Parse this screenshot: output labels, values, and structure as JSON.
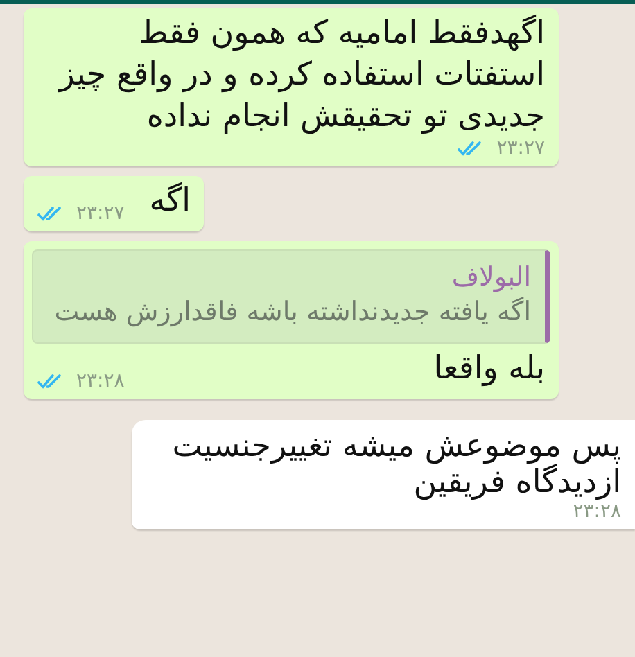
{
  "messages": [
    {
      "kind": "outgoing",
      "text": "اگهدفقط امامیه که همون فقط استفتات استفاده کرده و در واقع چیز جدیدی تو تحقیقش انجام نداده",
      "time": "۲۳:۲۷",
      "read": true
    },
    {
      "kind": "outgoing",
      "text": "اگه",
      "time": "۲۳:۲۷",
      "read": true
    },
    {
      "kind": "outgoing",
      "quote": {
        "author": "البولاف",
        "text": "اگه یافته جدیدنداشته باشه فاقدارزش هست"
      },
      "text": "بله واقعا",
      "time": "۲۳:۲۸",
      "read": true
    },
    {
      "kind": "incoming",
      "text": "پس موضوعش میشه تغییرجنسیت ازدیدگاه فریقین",
      "time": "۲۳:۲۸"
    }
  ]
}
